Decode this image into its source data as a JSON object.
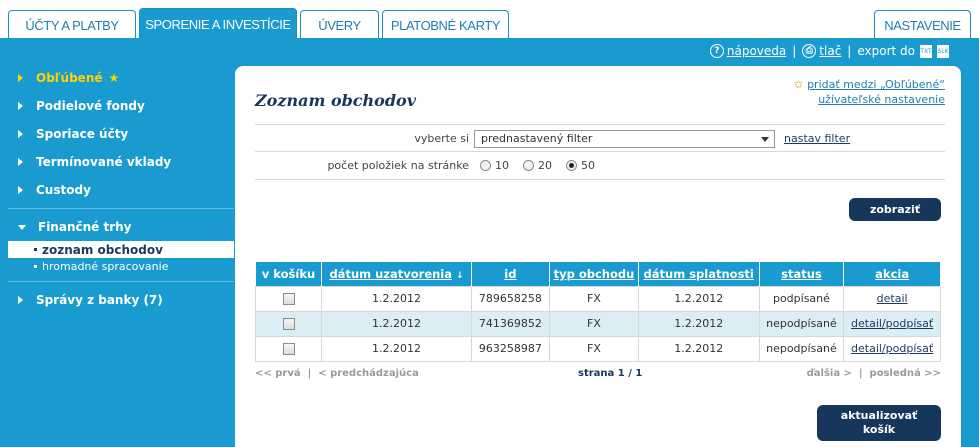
{
  "tabs": [
    {
      "label": "ÚČTY A PLATBY",
      "active": false
    },
    {
      "label": "SPORENIE A INVESTÍCIE",
      "active": true
    },
    {
      "label": "ÚVERY",
      "active": false
    },
    {
      "label": "PLATOBNÉ KARTY",
      "active": false
    },
    {
      "label": "NASTAVENIE",
      "active": false
    }
  ],
  "toolbar": {
    "help_icon": "?",
    "help_label": "nápoveda",
    "print_icon": "print-icon",
    "print_label": "tlač",
    "export_label": "export do",
    "export_txt": "TXT",
    "export_slk": "SLK"
  },
  "sidebar": {
    "favorites": "Obľúbené",
    "favorites_star": "★",
    "items": [
      {
        "label": "Podielové fondy"
      },
      {
        "label": "Sporiace účty"
      },
      {
        "label": "Termínované vklady"
      },
      {
        "label": "Custody"
      }
    ],
    "open_section": "Finančné trhy",
    "sub_items": [
      {
        "label": "zoznam obchodov",
        "active": true
      },
      {
        "label": "hromadné spracovanie",
        "active": false
      }
    ],
    "messages": "Správy z banky (7)"
  },
  "main": {
    "title": "Zoznam obchodov",
    "add_favorites": "pridať medzi „Obľúbené“",
    "user_settings": "užívateľské nastavenie",
    "filter_label": "vyberte si",
    "filter_value": "prednastavený filter",
    "filter_link": "nastav filter",
    "count_label": "počet položiek na stránke",
    "count_options": [
      "10",
      "20",
      "50"
    ],
    "count_selected": "50",
    "show_button": "zobraziť",
    "cart_button_line1": "aktualizovať",
    "cart_button_line2": "košík"
  },
  "table": {
    "headers": [
      "v košíku",
      "dátum uzatvorenia",
      "id",
      "typ obchodu",
      "dátum splatnosti",
      "status",
      "akcia"
    ],
    "sort_indicator": "↓",
    "rows": [
      {
        "date": "1.2.2012",
        "id": "789658258",
        "type": "FX",
        "maturity": "1.2.2012",
        "status": "podpísané",
        "action": "detail"
      },
      {
        "date": "1.2.2012",
        "id": "741369852",
        "type": "FX",
        "maturity": "1.2.2012",
        "status": "nepodpísané",
        "action": "detail/podpísať"
      },
      {
        "date": "1.2.2012",
        "id": "963258987",
        "type": "FX",
        "maturity": "1.2.2012",
        "status": "nepodpísané",
        "action": "detail/podpísať"
      }
    ]
  },
  "pager": {
    "first": "<< prvá",
    "prev": "< predchádzajúca",
    "page_label": "strana",
    "page_value": "1 / 1",
    "next": "ďalšia >",
    "last": "posledná >>"
  },
  "colors": {
    "primary": "#1a9bd0",
    "dark": "#16365c",
    "favorite": "#ffd200",
    "row_highlight": "#dbeef6"
  }
}
